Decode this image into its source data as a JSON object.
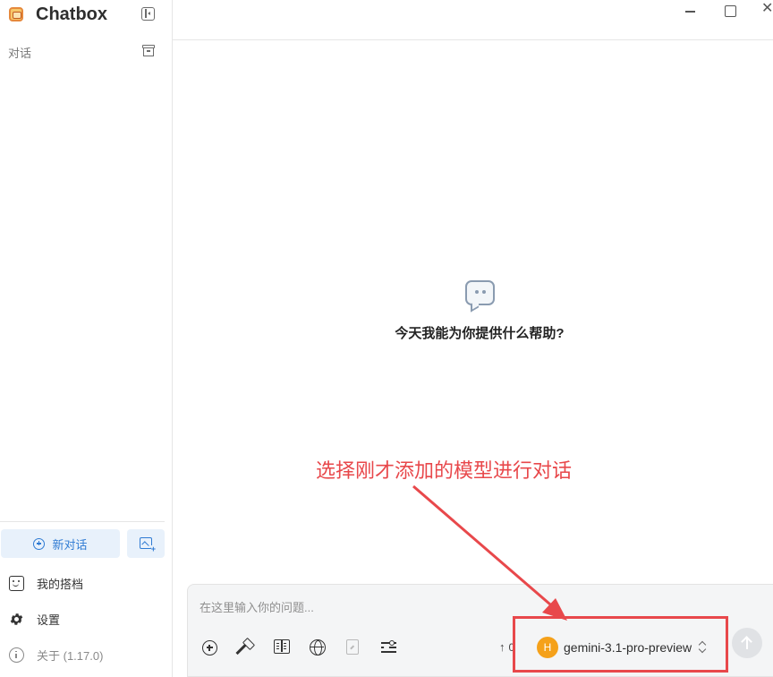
{
  "app": {
    "name": "Chatbox"
  },
  "sidebar": {
    "section_label": "对话",
    "new_chat_label": "新对话",
    "menu": {
      "profile_label": "我的搭档",
      "settings_label": "设置",
      "about_label": "关于 (1.17.0)"
    }
  },
  "main": {
    "empty_title": "今天我能为你提供什么帮助?"
  },
  "composer": {
    "placeholder": "在这里输入你的问题...",
    "token_count": "0",
    "model": {
      "avatar_letter": "H",
      "name": "gemini-3.1-pro-preview"
    }
  },
  "annotation": {
    "text": "选择刚才添加的模型进行对话",
    "color": "#e8484b"
  },
  "colors": {
    "accent": "#2f7bd3",
    "accent_bg": "#e8f1fb",
    "model_avatar": "#f5a11a"
  }
}
